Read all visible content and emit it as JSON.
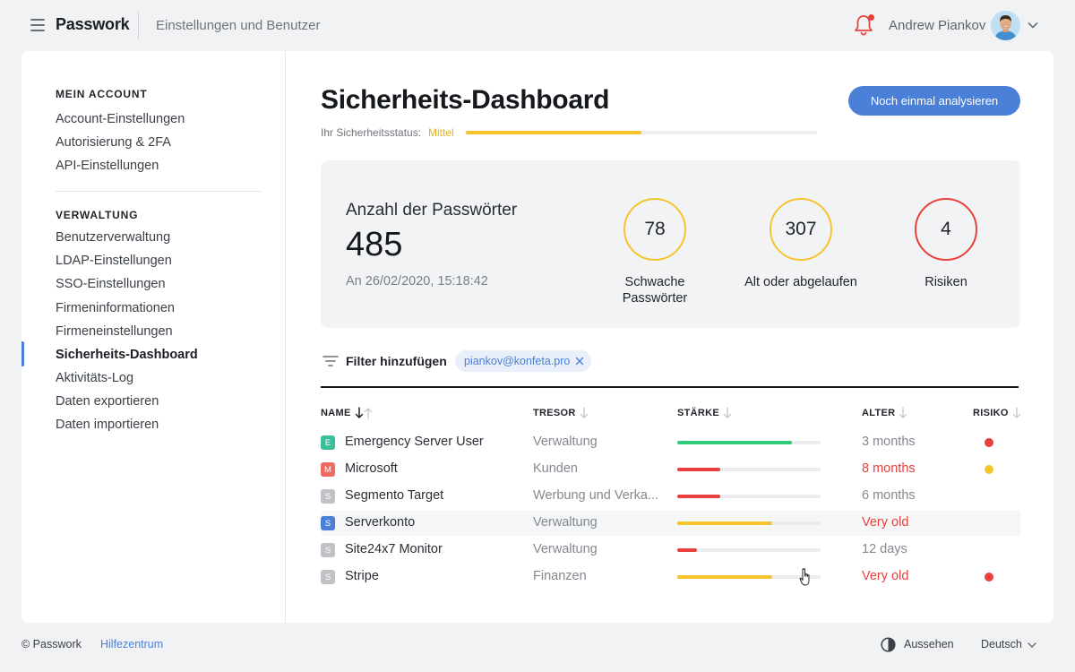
{
  "app": {
    "brand": "Passwork",
    "context": "Einstellungen und Benutzer",
    "user_name": "Andrew Piankov"
  },
  "sidebar": {
    "sections": [
      {
        "heading": "MEIN ACCOUNT",
        "items": [
          "Account-Einstellungen",
          "Autorisierung & 2FA",
          "API-Einstellungen"
        ]
      },
      {
        "heading": "VERWALTUNG",
        "items": [
          "Benutzerverwaltung",
          "LDAP-Einstellungen",
          "SSO-Einstellungen",
          "Firmeninformationen",
          "Firmeneinstellungen",
          "Sicherheits-Dashboard",
          "Aktivitäts-Log",
          "Daten exportieren",
          "Daten importieren"
        ]
      }
    ],
    "active_item": "Sicherheits-Dashboard"
  },
  "main": {
    "title": "Sicherheits-Dashboard",
    "analyze_button": "Noch einmal analysieren",
    "status_label": "Ihr Sicherheitsstatus:",
    "status_value": "Mittel",
    "status_level": 0.5,
    "stats": {
      "label": "Anzahl der Passwörter",
      "count": "485",
      "date": "An 26/02/2020, 15:18:42",
      "weak_value": "78",
      "weak_caption": "Schwache Passwörter",
      "old_value": "307",
      "old_caption": "Alt oder abgelaufen",
      "risk_value": "4",
      "risk_caption": "Risiken"
    },
    "filter_label": "Filter hinzufügen",
    "filter_chip": "piankov@konfeta.pro",
    "columns": {
      "name": "NAME",
      "vault": "TRESOR",
      "strength": "STÄRKE",
      "age": "ALTER",
      "risk": "RISIKO"
    },
    "rows": [
      {
        "letter": "E",
        "name": "Emergency Server User",
        "vault": "Verwaltung",
        "strength": 0.8,
        "strength_color": "#2ecb7a",
        "age": "3 months",
        "age_alert": false,
        "risk": "red"
      },
      {
        "letter": "M",
        "name": "Microsoft",
        "vault": "Kunden",
        "strength": 0.3,
        "strength_color": "#e8403c",
        "age": "8 months",
        "age_alert": true,
        "risk": "yellow"
      },
      {
        "letter": "S",
        "name": "Segmento Target",
        "vault": "Werbung und Verka...",
        "strength": 0.3,
        "strength_color": "#e8403c",
        "age": "6 months",
        "age_alert": false,
        "risk": ""
      },
      {
        "letter": "S",
        "name": "Serverkonto",
        "vault": "Verwaltung",
        "strength": 0.66,
        "strength_color": "#f5c42c",
        "age": "Very old",
        "age_alert": true,
        "risk": ""
      },
      {
        "letter": "S",
        "name": "Site24x7 Monitor",
        "vault": "Verwaltung",
        "strength": 0.14,
        "strength_color": "#e8403c",
        "age": "12 days",
        "age_alert": false,
        "risk": ""
      },
      {
        "letter": "S",
        "name": "Stripe",
        "vault": "Finanzen",
        "strength": 0.66,
        "strength_color": "#f5c42c",
        "age": "Very old",
        "age_alert": true,
        "risk": "red"
      }
    ],
    "badge_colors": {
      "E": "#3bbf9a",
      "M": "#ef6a62",
      "S_gray": "#bfc2c6",
      "S_blue": "#4a80d8"
    }
  },
  "footer": {
    "copyright": "© Passwork",
    "help": "Hilfezentrum",
    "appearance": "Aussehen",
    "language": "Deutsch"
  },
  "colors": {
    "accent": "#4a80d8",
    "warning": "#f5c42c",
    "danger": "#e8403c",
    "success": "#2ecb7a"
  }
}
